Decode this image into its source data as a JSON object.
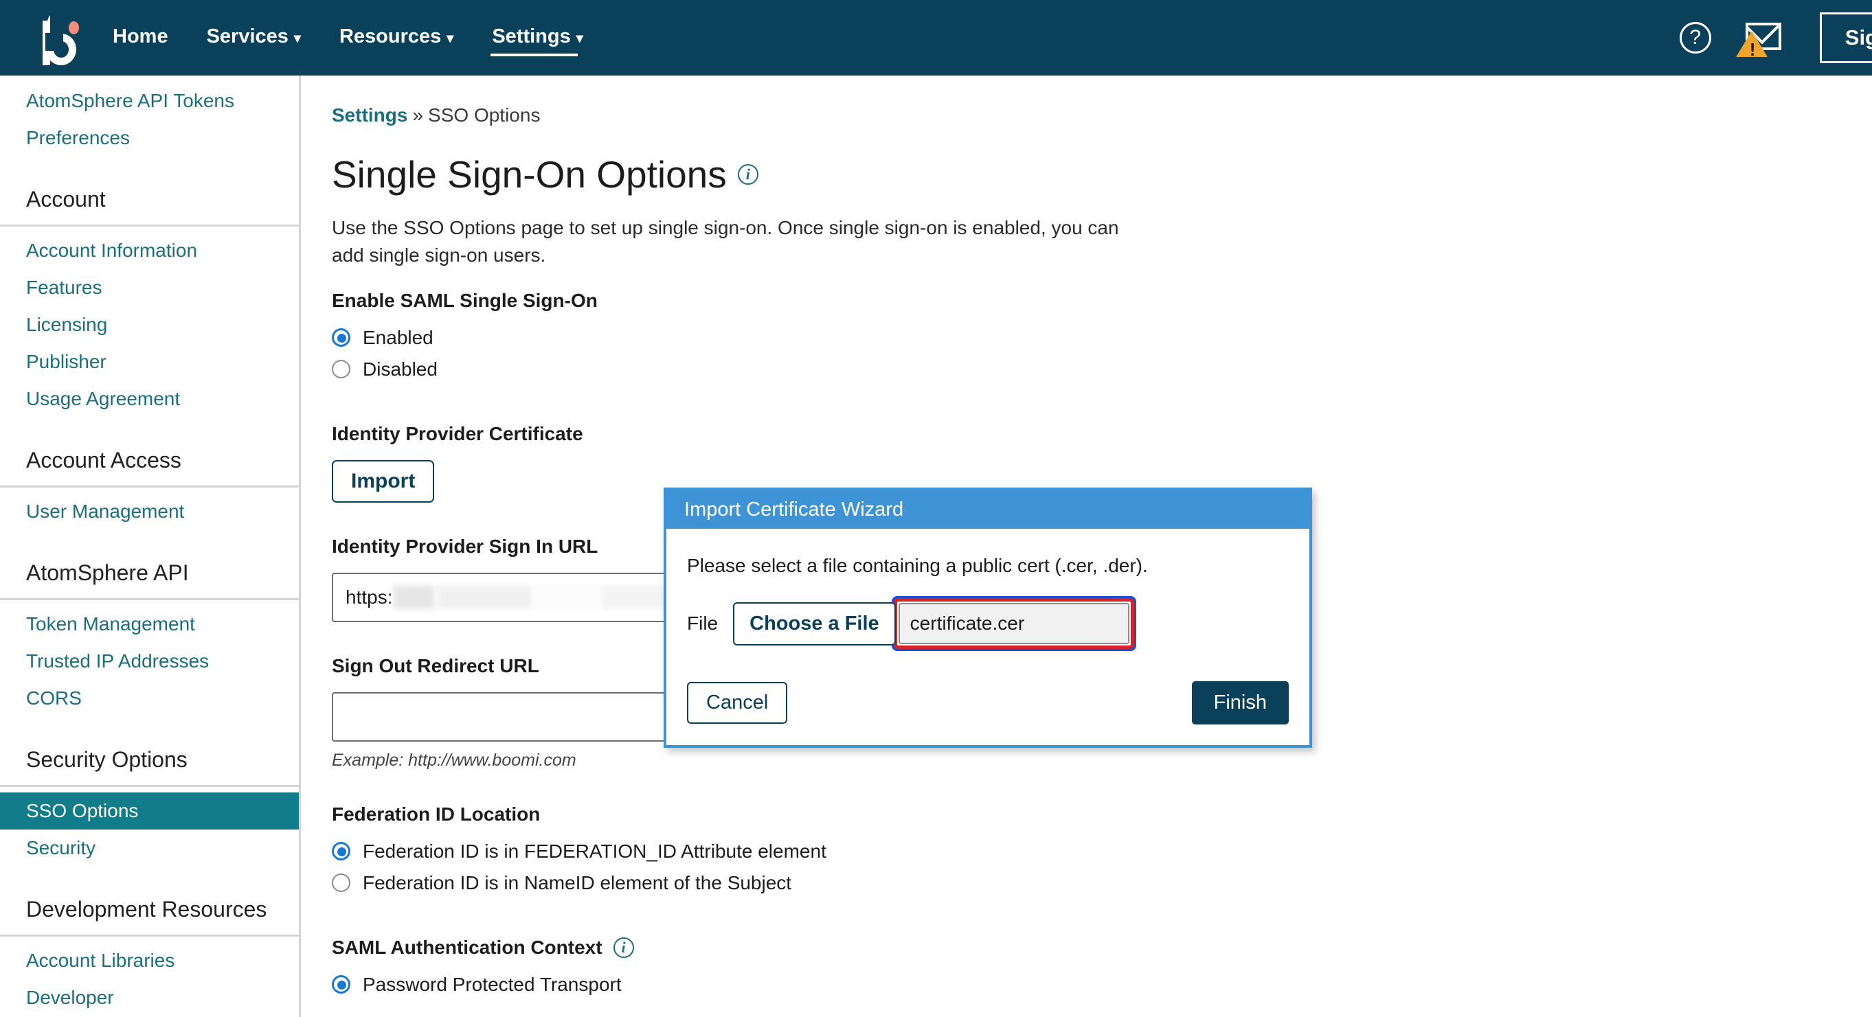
{
  "topnav": {
    "logo_name": "boomi-logo",
    "links": [
      {
        "label": "Home",
        "caret": "",
        "active": false
      },
      {
        "label": "Services",
        "caret": "▾",
        "active": false
      },
      {
        "label": "Resources",
        "caret": "▾",
        "active": false
      },
      {
        "label": "Settings",
        "caret": "▾",
        "active": true
      }
    ],
    "help_icon_glyph": "?",
    "mail_icon_name": "mail-warning-icon",
    "warning_glyph": "!",
    "signout_label": "Sig"
  },
  "sidebar": {
    "top_links": [
      {
        "label": "AtomSphere API Tokens",
        "selected": false
      },
      {
        "label": "Preferences",
        "selected": false
      }
    ],
    "sections": [
      {
        "title": "Account",
        "links": [
          {
            "label": "Account Information",
            "selected": false
          },
          {
            "label": "Features",
            "selected": false
          },
          {
            "label": "Licensing",
            "selected": false
          },
          {
            "label": "Publisher",
            "selected": false
          },
          {
            "label": "Usage Agreement",
            "selected": false
          }
        ]
      },
      {
        "title": "Account Access",
        "links": [
          {
            "label": "User Management",
            "selected": false
          }
        ]
      },
      {
        "title": "AtomSphere API",
        "links": [
          {
            "label": "Token Management",
            "selected": false
          },
          {
            "label": "Trusted IP Addresses",
            "selected": false
          },
          {
            "label": "CORS",
            "selected": false
          }
        ]
      },
      {
        "title": "Security Options",
        "links": [
          {
            "label": "SSO Options",
            "selected": true
          },
          {
            "label": "Security",
            "selected": false
          }
        ]
      },
      {
        "title": "Development Resources",
        "links": [
          {
            "label": "Account Libraries",
            "selected": false
          },
          {
            "label": "Developer",
            "selected": false
          }
        ]
      }
    ]
  },
  "main": {
    "breadcrumb": {
      "root": "Settings",
      "separator": "»",
      "current": "SSO Options"
    },
    "page_title": "Single Sign-On Options",
    "page_description": "Use the SSO Options page to set up single sign-on. Once single sign-on is enabled, you can add single sign-on users.",
    "enable_saml": {
      "label": "Enable SAML Single Sign-On",
      "options": [
        {
          "label": "Enabled",
          "selected": true
        },
        {
          "label": "Disabled",
          "selected": false
        }
      ]
    },
    "idp_certificate": {
      "label": "Identity Provider Certificate",
      "import_button": "Import"
    },
    "idp_signin_url": {
      "label": "Identity Provider Sign In URL",
      "value_prefix": "https:",
      "value_redacted": true
    },
    "signout_redirect_url": {
      "label": "Sign Out Redirect URL",
      "value": "",
      "hint": "Example: http://www.boomi.com"
    },
    "federation_id_location": {
      "label": "Federation ID Location",
      "options": [
        {
          "label": "Federation ID is in FEDERATION_ID Attribute element",
          "selected": true
        },
        {
          "label": "Federation ID is in NameID element of the Subject",
          "selected": false
        }
      ]
    },
    "saml_auth_context": {
      "label": "SAML Authentication Context",
      "options": [
        {
          "label": "Password Protected Transport",
          "selected": true
        }
      ]
    }
  },
  "modal": {
    "title": "Import Certificate Wizard",
    "instruction": "Please select a file containing a public cert (.cer, .der).",
    "file_label": "File",
    "choose_button": "Choose a File",
    "file_value": "certificate.cer",
    "cancel_button": "Cancel",
    "finish_button": "Finish"
  },
  "colors": {
    "nav_bg": "#0a4059",
    "link_teal": "#1a6e7e",
    "selected_teal": "#127d8a",
    "modal_header_blue": "#3e92d6",
    "focus_blue": "#1c4fd8",
    "annotation_red": "#d82327",
    "accent_coral": "#f58d7d",
    "warning_orange": "#f0a52a"
  }
}
